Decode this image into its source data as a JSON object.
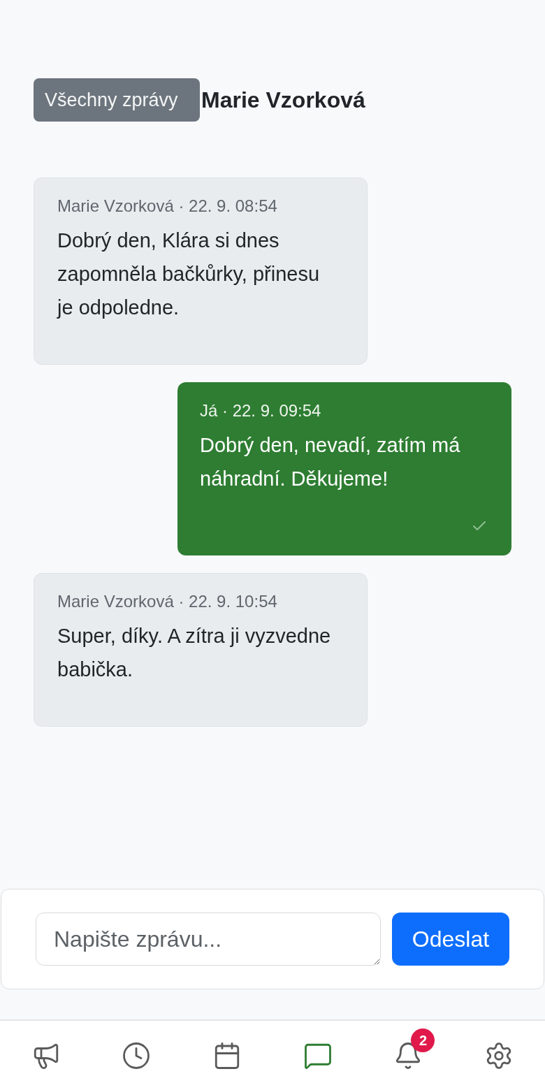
{
  "header": {
    "back_button": "Všechny zprávy",
    "title": "Marie Vzorková"
  },
  "messages": [
    {
      "kind": "received",
      "meta": "Marie Vzorková · 22. 9. 08:54",
      "text": "Dobrý den, Klára si dnes zapomněla bačkůrky, přinesu je odpoledne."
    },
    {
      "kind": "sent",
      "meta": "Já · 22. 9. 09:54",
      "text": "Dobrý den, nevadí, zatím má náhradní. Děkujeme!",
      "read": true
    },
    {
      "kind": "received",
      "meta": "Marie Vzorková · 22. 9. 10:54",
      "text": "Super, díky. A zítra ji vyzvedne babička."
    }
  ],
  "composer": {
    "placeholder": "Napište zprávu...",
    "send_button": "Odeslat"
  },
  "nav": [
    {
      "kind": "announcements",
      "selected": false
    },
    {
      "kind": "history",
      "selected": false
    },
    {
      "kind": "calendar",
      "selected": false
    },
    {
      "kind": "messages",
      "selected": true
    },
    {
      "kind": "notifications",
      "selected": false,
      "badge": "2"
    },
    {
      "kind": "settings",
      "selected": false
    }
  ]
}
